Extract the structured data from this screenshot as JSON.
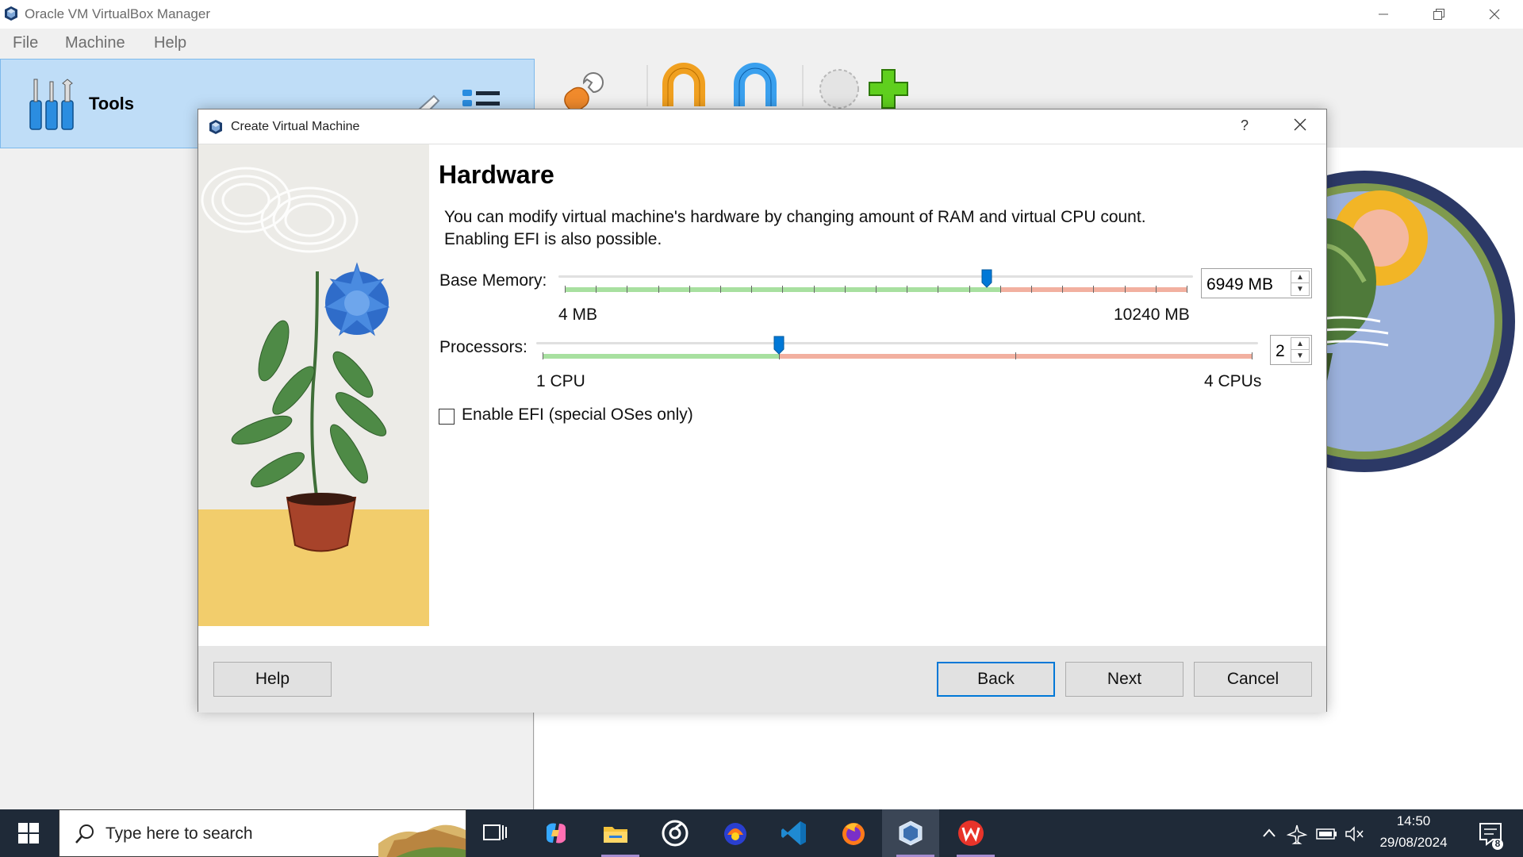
{
  "window": {
    "title": "Oracle VM VirtualBox Manager",
    "controls": [
      "minimize",
      "restore",
      "close"
    ]
  },
  "menu": [
    "File",
    "Machine",
    "Help"
  ],
  "tools_pane": {
    "label": "Tools"
  },
  "dialog": {
    "title": "Create Virtual Machine",
    "help_glyph": "?",
    "heading": "Hardware",
    "description_line1": "You can modify virtual machine's hardware by changing amount of RAM and virtual CPU count.",
    "description_line2": "Enabling EFI is also possible.",
    "memory": {
      "label": "Base Memory:",
      "min_label": "4 MB",
      "max_label": "10240 MB",
      "value": "6949 MB",
      "min": 4,
      "max": 10240,
      "current": 6949,
      "recommended_max": 7168
    },
    "processors": {
      "label": "Processors:",
      "min_label": "1 CPU",
      "max_label": "4 CPUs",
      "value": "2",
      "min": 1,
      "max": 4,
      "current": 2,
      "recommended_max": 2
    },
    "efi": {
      "label": "Enable EFI (special OSes only)",
      "checked": false
    },
    "buttons": {
      "help": "Help",
      "back": "Back",
      "next": "Next",
      "cancel": "Cancel"
    }
  },
  "taskbar": {
    "search_placeholder": "Type here to search",
    "time": "14:50",
    "date": "29/08/2024",
    "notification_count": "8",
    "apps": [
      "task-view",
      "copilot",
      "file-explorer",
      "obs",
      "media-app",
      "vscode",
      "firefox",
      "virtualbox",
      "wps-office"
    ]
  },
  "colors": {
    "accent": "#0078d7",
    "slider_ok": "#a8e0a0",
    "slider_warn": "#f2b0a0",
    "tools_selected": "#bfddf7"
  }
}
